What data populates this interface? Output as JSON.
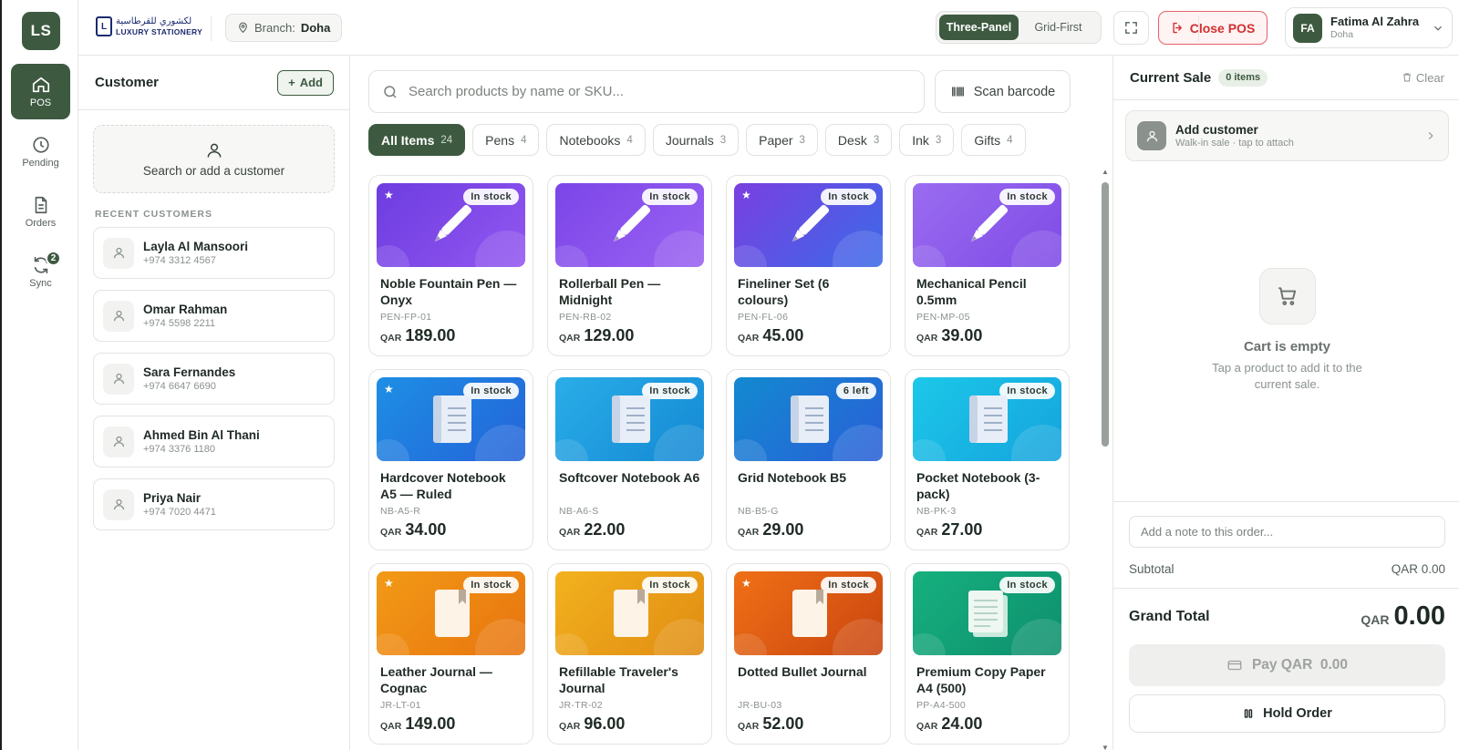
{
  "rail": {
    "logo": "LS",
    "items": [
      {
        "label": "POS",
        "icon": "home-icon"
      },
      {
        "label": "Pending",
        "icon": "clock-icon"
      },
      {
        "label": "Orders",
        "icon": "document-icon"
      },
      {
        "label": "Sync",
        "icon": "sync-icon",
        "badge": "2"
      }
    ]
  },
  "header": {
    "brand_arabic": "لكشوري للقرطاسية",
    "brand_english": "LUXURY STATIONERY",
    "branch_label": "Branch:",
    "branch_value": "Doha",
    "layout_options": [
      "Three-Panel",
      "Grid-First"
    ],
    "layout_selected": "Three-Panel",
    "close_pos": "Close POS",
    "user": {
      "initials": "FA",
      "name": "Fatima Al Zahra",
      "branch": "Doha"
    }
  },
  "customer_panel": {
    "title": "Customer",
    "add_label": "Add",
    "search_label": "Search or add a customer",
    "recent_label": "RECENT CUSTOMERS",
    "customers": [
      {
        "name": "Layla Al Mansoori",
        "phone": "+974 3312 4567"
      },
      {
        "name": "Omar Rahman",
        "phone": "+974 5598 2211"
      },
      {
        "name": "Sara Fernandes",
        "phone": "+974 6647 6690"
      },
      {
        "name": "Ahmed Bin Al Thani",
        "phone": "+974 3376 1180"
      },
      {
        "name": "Priya Nair",
        "phone": "+974 7020 4471"
      }
    ]
  },
  "products": {
    "search_placeholder": "Search products by name or SKU...",
    "scan_label": "Scan barcode",
    "categories": [
      {
        "label": "All Items",
        "count": "24",
        "active": true
      },
      {
        "label": "Pens",
        "count": "4"
      },
      {
        "label": "Notebooks",
        "count": "4"
      },
      {
        "label": "Journals",
        "count": "3"
      },
      {
        "label": "Paper",
        "count": "3"
      },
      {
        "label": "Desk",
        "count": "3"
      },
      {
        "label": "Ink",
        "count": "3"
      },
      {
        "label": "Gifts",
        "count": "4"
      }
    ],
    "currency": "QAR",
    "items": [
      {
        "name": "Noble Fountain Pen — Onyx",
        "sku": "PEN-FP-01",
        "price": "189.00",
        "stock": "In stock",
        "featured": true,
        "icon": "pen",
        "colors": [
          "#6d3ce0",
          "#9257f0"
        ]
      },
      {
        "name": "Rollerball Pen — Midnight",
        "sku": "PEN-RB-02",
        "price": "129.00",
        "stock": "In stock",
        "featured": false,
        "icon": "pen",
        "colors": [
          "#7b45e8",
          "#9a62f2"
        ]
      },
      {
        "name": "Fineliner Set (6 colours)",
        "sku": "PEN-FL-06",
        "price": "45.00",
        "stock": "In stock",
        "featured": true,
        "icon": "pen",
        "colors": [
          "#7a3fe0",
          "#3b6ae8"
        ]
      },
      {
        "name": "Mechanical Pencil 0.5mm",
        "sku": "PEN-MP-05",
        "price": "39.00",
        "stock": "In stock",
        "featured": false,
        "icon": "pen",
        "colors": [
          "#9a6cf0",
          "#7f4be6"
        ]
      },
      {
        "name": "Hardcover Notebook A5 — Ruled",
        "sku": "NB-A5-R",
        "price": "34.00",
        "stock": "In stock",
        "featured": true,
        "icon": "notebook",
        "colors": [
          "#1d8fe4",
          "#2563d9"
        ]
      },
      {
        "name": "Softcover Notebook A6",
        "sku": "NB-A6-S",
        "price": "22.00",
        "stock": "In stock",
        "featured": false,
        "icon": "notebook",
        "colors": [
          "#2aaee8",
          "#1488d4"
        ]
      },
      {
        "name": "Grid Notebook B5",
        "sku": "NB-B5-G",
        "price": "29.00",
        "stock": "6 left",
        "featured": false,
        "icon": "notebook",
        "colors": [
          "#128ad0",
          "#2a5fd8"
        ]
      },
      {
        "name": "Pocket Notebook (3-pack)",
        "sku": "NB-PK-3",
        "price": "27.00",
        "stock": "In stock",
        "featured": false,
        "icon": "notebook",
        "colors": [
          "#1cc8e8",
          "#15a3de"
        ]
      },
      {
        "name": "Leather Journal — Cognac",
        "sku": "JR-LT-01",
        "price": "149.00",
        "stock": "In stock",
        "featured": true,
        "icon": "journal",
        "colors": [
          "#f29a16",
          "#e8740f"
        ]
      },
      {
        "name": "Refillable Traveler's Journal",
        "sku": "JR-TR-02",
        "price": "96.00",
        "stock": "In stock",
        "featured": false,
        "icon": "journal",
        "colors": [
          "#f3b21e",
          "#e08c12"
        ]
      },
      {
        "name": "Dotted Bullet Journal",
        "sku": "JR-BU-03",
        "price": "52.00",
        "stock": "In stock",
        "featured": true,
        "icon": "journal",
        "colors": [
          "#f07016",
          "#c9450f"
        ]
      },
      {
        "name": "Premium Copy Paper A4 (500)",
        "sku": "PP-A4-500",
        "price": "24.00",
        "stock": "In stock",
        "featured": false,
        "icon": "paper",
        "colors": [
          "#16b07e",
          "#0e8f6e"
        ]
      }
    ]
  },
  "cart": {
    "title": "Current Sale",
    "items_badge": "0 items",
    "clear_label": "Clear",
    "add_customer_title": "Add customer",
    "add_customer_sub": "Walk-in sale · tap to attach",
    "empty_title": "Cart is empty",
    "empty_sub": "Tap a product to add it to the current sale.",
    "note_placeholder": "Add a note to this order...",
    "subtotal_label": "Subtotal",
    "subtotal_value": "QAR 0.00",
    "grand_total_label": "Grand Total",
    "grand_total_currency": "QAR",
    "grand_total_value": "0.00",
    "pay_label": "Pay QAR  0.00",
    "hold_label": "Hold Order"
  },
  "colors": {
    "brand": "#3d5a40",
    "danger": "#d32f2f",
    "brand_logo": "#1c2b6e"
  }
}
